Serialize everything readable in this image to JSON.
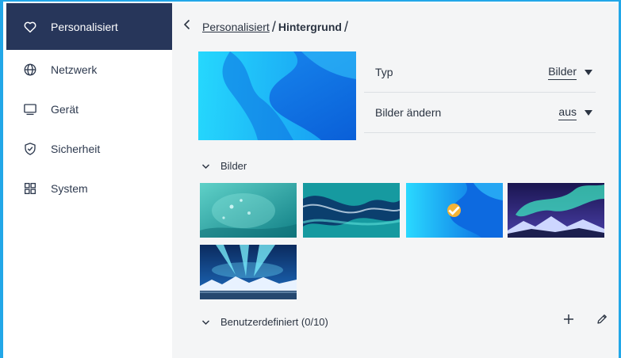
{
  "sidebar": {
    "items": [
      {
        "label": "Personalisiert",
        "icon": "heart-icon",
        "active": true
      },
      {
        "label": "Netzwerk",
        "icon": "globe-icon",
        "active": false
      },
      {
        "label": "Gerät",
        "icon": "monitor-icon",
        "active": false
      },
      {
        "label": "Sicherheit",
        "icon": "shield-check-icon",
        "active": false
      },
      {
        "label": "System",
        "icon": "grid-icon",
        "active": false
      }
    ]
  },
  "breadcrumb": {
    "back_icon": "chevron-left-icon",
    "parent": "Personalisiert",
    "current": "Hintergrund",
    "separator": "/"
  },
  "settings": {
    "type_label": "Typ",
    "type_value": "Bilder",
    "change_label": "Bilder ändern",
    "change_value": "aus"
  },
  "sections": {
    "images_label": "Bilder",
    "custom_label": "Benutzerdefiniert (0/10)"
  },
  "images": [
    {
      "name": "Teal water droplets",
      "selected": false
    },
    {
      "name": "Teal marble swirl",
      "selected": false
    },
    {
      "name": "Blue abstract wave",
      "selected": true
    },
    {
      "name": "Aurora over mountains",
      "selected": false
    },
    {
      "name": "Aurora over icy coast",
      "selected": false
    }
  ],
  "colors": {
    "accent": "#22a7e8",
    "sidebar_active": "#27365a",
    "check": "#f5b335",
    "main_bg": "#f4f5f6"
  }
}
